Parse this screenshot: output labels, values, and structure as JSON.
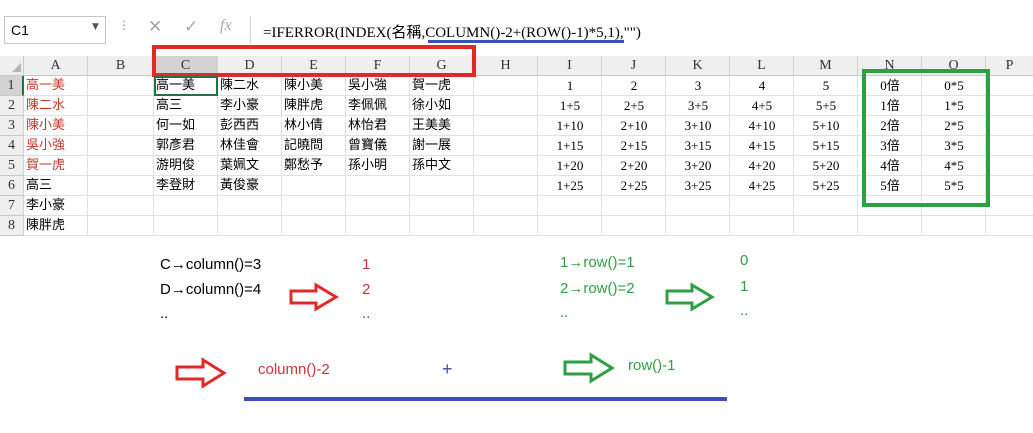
{
  "formula_bar": {
    "name_box": "C1",
    "formula": "=IFERROR(INDEX(名稱,COLUMN()-2+(ROW()-1)*5,1),\"\")",
    "cancel_icon": "close-icon",
    "enter_icon": "check-icon",
    "function_icon": "fx-icon",
    "fx_label": "fx"
  },
  "columns": [
    "A",
    "B",
    "C",
    "D",
    "E",
    "F",
    "G",
    "H",
    "I",
    "J",
    "K",
    "L",
    "M",
    "N",
    "O",
    "P"
  ],
  "rows": [
    "1",
    "2",
    "3",
    "4",
    "5",
    "6",
    "7",
    "8"
  ],
  "active_cell": "C1",
  "colA": [
    "高一美",
    "陳二水",
    "陳小美",
    "吳小強",
    "賀一虎",
    "高三",
    "李小豪",
    "陳胖虎"
  ],
  "name_table": [
    [
      "高一美",
      "陳二水",
      "陳小美",
      "吳小強",
      "賀一虎"
    ],
    [
      "高三",
      "李小豪",
      "陳胖虎",
      "李佩佩",
      "徐小如"
    ],
    [
      "何一如",
      "彭西西",
      "林小倩",
      "林怡君",
      "王美美"
    ],
    [
      "郭彥君",
      "林佳會",
      "記曉問",
      "曾寶儀",
      "謝一展"
    ],
    [
      "游明俊",
      "葉姵文",
      "鄭愁予",
      "孫小明",
      "孫中文"
    ],
    [
      "李登財",
      "黃俊豪",
      "",
      "",
      ""
    ]
  ],
  "index_table": [
    [
      "1",
      "2",
      "3",
      "4",
      "5"
    ],
    [
      "1+5",
      "2+5",
      "3+5",
      "4+5",
      "5+5"
    ],
    [
      "1+10",
      "2+10",
      "3+10",
      "4+10",
      "5+10"
    ],
    [
      "1+15",
      "2+15",
      "3+15",
      "4+15",
      "5+15"
    ],
    [
      "1+20",
      "2+20",
      "3+20",
      "4+20",
      "5+20"
    ],
    [
      "1+25",
      "2+25",
      "3+25",
      "4+25",
      "5+25"
    ]
  ],
  "multiplier_table": [
    [
      "0倍",
      "0*5"
    ],
    [
      "1倍",
      "1*5"
    ],
    [
      "2倍",
      "2*5"
    ],
    [
      "3倍",
      "3*5"
    ],
    [
      "4倍",
      "4*5"
    ],
    [
      "5倍",
      "5*5"
    ]
  ],
  "annotations": {
    "col_c": "C→column()=3",
    "col_d": "D→column()=4",
    "col_dots": "..",
    "red_1": "1",
    "red_2": "2",
    "red_dots": "..",
    "row_1": "1→row()=1",
    "row_2": "2→row()=2",
    "row_dots": "..",
    "green_0": "0",
    "green_1": "1",
    "green_dots": "..",
    "bottom_left": "column()-2",
    "plus": "+",
    "bottom_right": "row()-1"
  },
  "colors": {
    "red": "#d0333a",
    "green": "#2ea043",
    "blue": "#3a4fc0",
    "excel_green": "#217346"
  }
}
